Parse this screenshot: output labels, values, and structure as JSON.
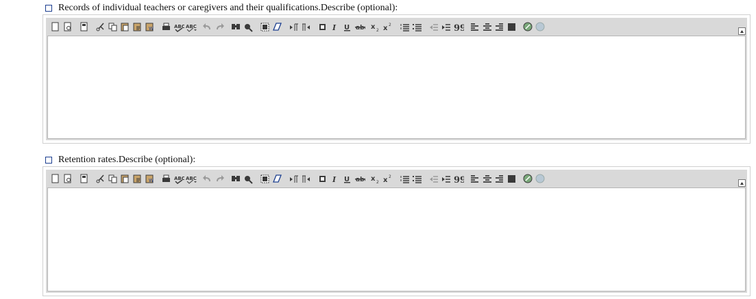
{
  "fields": [
    {
      "label": "Records of individual teachers or caregivers and their qualifications.Describe (optional):",
      "value": ""
    },
    {
      "label": "Retention rates.Describe (optional):",
      "value": ""
    }
  ],
  "toolbar": {
    "groups": [
      [
        "new-page-icon",
        "preview-icon"
      ],
      [
        "templates-icon"
      ],
      [
        "cut-icon",
        "copy-icon",
        "paste-icon",
        "paste-text-icon",
        "paste-word-icon"
      ],
      [
        "print-icon",
        "spellcheck-icon",
        "spellcheck-dropdown-icon"
      ],
      [
        "undo-icon",
        "redo-icon"
      ],
      [
        "find-icon",
        "replace-icon"
      ],
      [
        "select-all-icon",
        "remove-format-icon"
      ],
      [
        "ltr-icon",
        "rtl-icon"
      ],
      [
        "bold-icon",
        "italic-icon",
        "underline-icon",
        "strikethrough-icon"
      ],
      [
        "subscript-icon",
        "superscript-icon"
      ],
      [
        "numbered-list-icon",
        "bulleted-list-icon"
      ],
      [
        "outdent-icon",
        "indent-icon",
        "blockquote-icon"
      ],
      [
        "align-left-icon",
        "align-center-icon",
        "align-right-icon",
        "align-justify-icon"
      ],
      [
        "link-icon",
        "unlink-icon"
      ]
    ]
  },
  "colors": {
    "checkbox_border": "#1a3d8f",
    "toolbar_bg": "#d9d9d9",
    "icon": "#3a3a3a",
    "icon_disabled": "#9a9a9a"
  }
}
